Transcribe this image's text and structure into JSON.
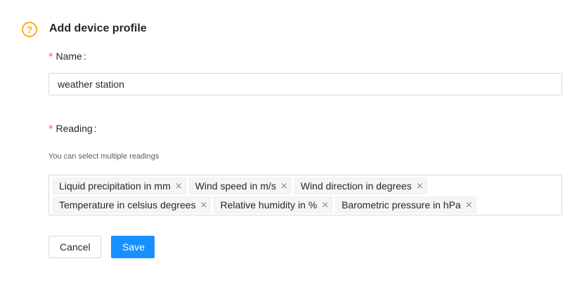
{
  "dialog": {
    "title": "Add device profile",
    "help_icon_glyph": "?"
  },
  "form": {
    "name": {
      "required_mark": "*",
      "label": "Name",
      "colon": ":",
      "value": "weather station"
    },
    "reading": {
      "required_mark": "*",
      "label": "Reading",
      "colon": ":",
      "hint": "You can select multiple readings",
      "selected": [
        "Liquid precipitation in mm",
        "Wind speed in m/s",
        "Wind direction in degrees",
        "Temperature in celsius degrees",
        "Relative humidity in %",
        "Barometric pressure in hPa"
      ],
      "remove_glyph": "×"
    }
  },
  "actions": {
    "cancel_label": "Cancel",
    "save_label": "Save"
  },
  "colors": {
    "primary": "#1890ff",
    "warning": "#faad14",
    "required": "#ff4d4f"
  }
}
